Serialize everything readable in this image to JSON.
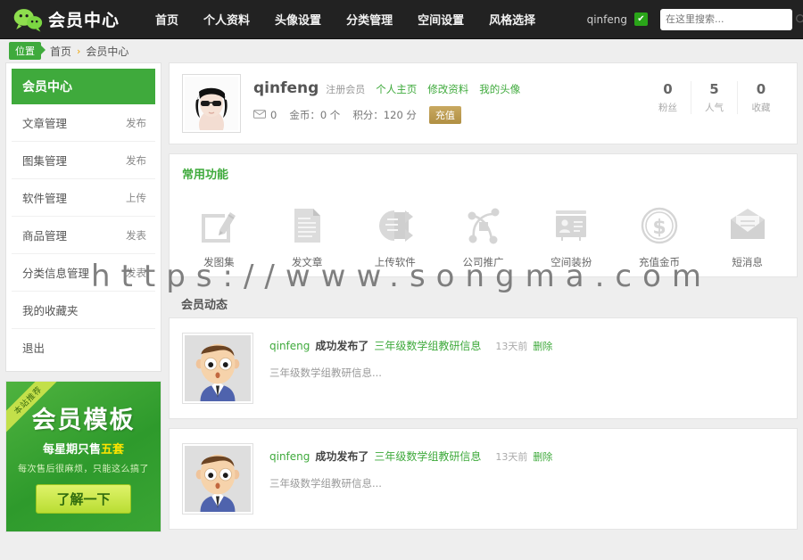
{
  "header": {
    "brand": "会员中心",
    "logo_icon": "wechat-logo-icon",
    "nav": [
      {
        "label": "首页"
      },
      {
        "label": "个人资料"
      },
      {
        "label": "头像设置"
      },
      {
        "label": "分类管理"
      },
      {
        "label": "空间设置"
      },
      {
        "label": "风格选择"
      }
    ],
    "user": "qinfeng",
    "user_badge_icon": "check-badge-icon",
    "search": {
      "placeholder": "在这里搜索...",
      "value": "",
      "icon": "search-icon"
    }
  },
  "breadcrumb": {
    "badge": "位置",
    "home": "首页",
    "sep": "›",
    "current": "会员中心"
  },
  "sidebar": {
    "head": "会员中心",
    "items": [
      {
        "label": "文章管理",
        "action": "发布"
      },
      {
        "label": "图集管理",
        "action": "发布"
      },
      {
        "label": "软件管理",
        "action": "上传"
      },
      {
        "label": "商品管理",
        "action": "发表"
      },
      {
        "label": "分类信息管理",
        "action": "发表"
      },
      {
        "label": "我的收藏夹",
        "action": ""
      },
      {
        "label": "退出",
        "action": ""
      }
    ],
    "promo": {
      "ribbon": "本站推荐",
      "title": "会员模板",
      "subtitle_prefix": "每星期只售",
      "subtitle_highlight": "五套",
      "small": "每次售后很麻烦，只能这么搞了",
      "button": "了解一下"
    }
  },
  "profile": {
    "avatar_icon": "user-avatar-photo",
    "name": "qinfeng",
    "group": "注册会员",
    "links": [
      "个人主页",
      "修改资料",
      "我的头像"
    ],
    "mail_icon": "envelope-icon",
    "mail_count": "0",
    "coins": "金币：0 个",
    "points": "积分：120 分",
    "recharge": "充值",
    "stats": [
      {
        "num": "0",
        "label": "粉丝"
      },
      {
        "num": "5",
        "label": "人气"
      },
      {
        "num": "0",
        "label": "收藏"
      }
    ]
  },
  "functions": {
    "title": "常用功能",
    "items": [
      {
        "label": "发图集",
        "icon": "pencil-square-icon"
      },
      {
        "label": "发文章",
        "icon": "document-lines-icon"
      },
      {
        "label": "上传软件",
        "icon": "upload-box-icon"
      },
      {
        "label": "公司推广",
        "icon": "node-graph-icon"
      },
      {
        "label": "空间装扮",
        "icon": "id-card-icon"
      },
      {
        "label": "充值金币",
        "icon": "dollar-coin-icon"
      },
      {
        "label": "短消息",
        "icon": "envelope-open-icon"
      }
    ]
  },
  "feed": {
    "title": "会员动态",
    "items": [
      {
        "avatar_icon": "cartoon-face-avatar",
        "user": "qinfeng",
        "action": "成功发布了",
        "object": "三年级数学组教研信息",
        "time": "13天前",
        "delete": "删除",
        "desc": "三年级数学组教研信息..."
      },
      {
        "avatar_icon": "cartoon-face-avatar",
        "user": "qinfeng",
        "action": "成功发布了",
        "object": "三年级数学组教研信息",
        "time": "13天前",
        "delete": "删除",
        "desc": "三年级数学组教研信息..."
      }
    ]
  },
  "watermark": "https://www.songma.com",
  "colors": {
    "brand_green": "#3faa3c",
    "navbar_bg": "#222222",
    "page_bg": "#eeeeee",
    "gold": "#b08f43"
  }
}
